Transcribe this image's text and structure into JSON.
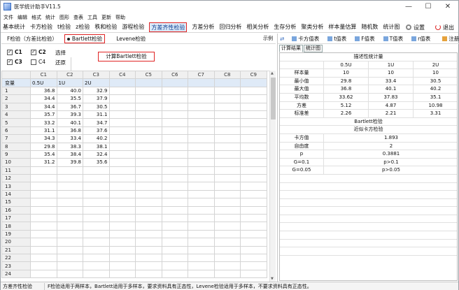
{
  "title": "医学统计助手V11.5",
  "window_controls": {
    "minimize": "—",
    "maximize": "☐",
    "close": "✕"
  },
  "menu": [
    "文件",
    "编辑",
    "格式",
    "统计",
    "图形",
    "查表",
    "工具",
    "更新",
    "帮助"
  ],
  "modules": [
    "基本统计",
    "卡方检验",
    "t检验",
    "z检验",
    "秩和检验",
    "游程检验",
    "方差齐性检验",
    "方差分析",
    "回归分析",
    "相关分析",
    "生存分析",
    "聚类分析",
    "样本量估算",
    "随机数",
    "统计图"
  ],
  "active_module_index": 6,
  "settings_label": "设置",
  "exit_label": "退出",
  "test_tabs": {
    "f_test": "F检验（方差比检验）",
    "bartlett": "Bartlett检验",
    "levene": "Levene检验",
    "example": "示例"
  },
  "checkboxes": [
    {
      "label": "C1",
      "checked": true,
      "bold": true
    },
    {
      "label": "C2",
      "checked": true,
      "bold": true
    },
    {
      "label": "C3",
      "checked": true,
      "bold": true
    },
    {
      "label": "C4",
      "checked": false,
      "bold": false
    }
  ],
  "select_label": "选择",
  "restore_label": "还原",
  "calc_button": "计算Bartlett检验",
  "grid": {
    "columns": [
      "C1",
      "C2",
      "C3",
      "C4",
      "C5",
      "C6",
      "C7",
      "C8",
      "C9"
    ],
    "var_row_label": "变量",
    "var_names": [
      "0.5U",
      "1U",
      "2U",
      "",
      "",
      "",
      "",
      "",
      ""
    ],
    "rows": [
      [
        "1",
        "36.8",
        "40.0",
        "32.9"
      ],
      [
        "2",
        "34.4",
        "35.5",
        "37.9"
      ],
      [
        "3",
        "34.4",
        "36.7",
        "30.5"
      ],
      [
        "4",
        "35.7",
        "39.3",
        "31.1"
      ],
      [
        "5",
        "33.2",
        "40.1",
        "34.7"
      ],
      [
        "6",
        "31.1",
        "36.8",
        "37.6"
      ],
      [
        "7",
        "34.3",
        "33.4",
        "40.2"
      ],
      [
        "8",
        "29.8",
        "38.3",
        "38.1"
      ],
      [
        "9",
        "35.4",
        "38.4",
        "32.4"
      ],
      [
        "10",
        "31.2",
        "39.8",
        "35.6"
      ],
      [
        "11"
      ],
      [
        "12"
      ],
      [
        "13"
      ],
      [
        "14"
      ],
      [
        "15"
      ],
      [
        "16"
      ],
      [
        "17"
      ],
      [
        "18"
      ],
      [
        "19"
      ],
      [
        "20"
      ],
      [
        "21"
      ],
      [
        "22"
      ],
      [
        "23"
      ],
      [
        "24"
      ]
    ]
  },
  "right_toolbar": [
    "卡方值表",
    "t值表",
    "F值表",
    "T值表",
    "r值表",
    "注册"
  ],
  "result_tabs": [
    "计算结果",
    "统计图"
  ],
  "result": {
    "desc_title": "描述性统计量",
    "groups": [
      "0.5U",
      "1U",
      "2U"
    ],
    "desc_rows": [
      {
        "label": "样本量",
        "values": [
          "10",
          "10",
          "10"
        ]
      },
      {
        "label": "最小值",
        "values": [
          "29.8",
          "33.4",
          "30.5"
        ]
      },
      {
        "label": "最大值",
        "values": [
          "36.8",
          "40.1",
          "40.2"
        ]
      },
      {
        "label": "平均数",
        "values": [
          "33.62",
          "37.83",
          "35.1"
        ]
      },
      {
        "label": "方差",
        "values": [
          "5.12",
          "4.87",
          "10.98"
        ]
      },
      {
        "label": "标准差",
        "values": [
          "2.26",
          "2.21",
          "3.31"
        ]
      }
    ],
    "bartlett_title": "Bartlett检验",
    "approx_title": "近似卡方检验",
    "test_rows": [
      {
        "label": "卡方值",
        "value": "1.893"
      },
      {
        "label": "自由度",
        "value": "2"
      },
      {
        "label": "p",
        "value": "0.3881"
      },
      {
        "label": "G=0.1",
        "value": "p>0.1"
      },
      {
        "label": "G=0.05",
        "value": "p>0.05"
      }
    ]
  },
  "status": {
    "left": "方差齐性检验",
    "message": "F检验适用于两样本，Bartlett适用于多样本，要求资料具有正态性，Levene检验适用于多样本，不要求资料具有正态性。"
  }
}
